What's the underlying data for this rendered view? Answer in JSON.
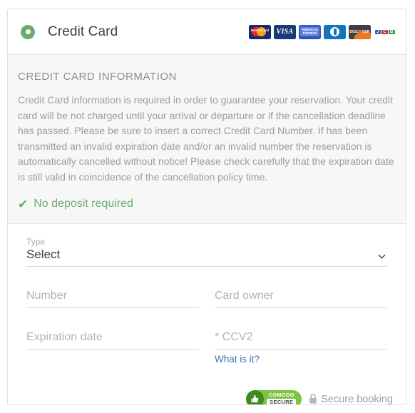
{
  "header": {
    "radio_icon": "radio-selected-icon",
    "title": "Credit Card",
    "card_logos": [
      {
        "name": "mastercard",
        "label": "MasterCard"
      },
      {
        "name": "visa",
        "label": "VISA"
      },
      {
        "name": "american-express",
        "label1": "AMERICAN",
        "label2": "EXPRESS"
      },
      {
        "name": "diners-club",
        "label": "Diners Club"
      },
      {
        "name": "discover",
        "label_a": "DISC",
        "label_b": "VER"
      },
      {
        "name": "jcb",
        "label1": "J",
        "label2": "C",
        "label3": "B"
      }
    ]
  },
  "info": {
    "heading": "CREDIT CARD INFORMATION",
    "paragraph": "Credit Card information is required in order to guarantee your reservation. Your credit card will be not charged until your arrival or departure or if the cancellation deadline has passed. Please be sure to insert a correct Credit Card Number. If has been transmitted an invalid expiration date and/or an invalid number the reservation is automatically cancelled without notice! Please check carefully that the expiration date is still valid in coincidence of the cancellation policy time.",
    "deposit_icon": "check-icon",
    "deposit_text": "No deposit required"
  },
  "form": {
    "type_label": "Type",
    "type_value": "Select",
    "type_chevron_icon": "chevron-down-icon",
    "number_placeholder": "Number",
    "card_owner_placeholder": "Card owner",
    "expiration_placeholder": "Expiration date",
    "ccv2_placeholder": "* CCV2",
    "ccv2_help_link": "What is it?"
  },
  "footer": {
    "comodo_line1": "COMODO",
    "comodo_line2": "SECURE",
    "comodo_icon": "thumbs-up-icon",
    "lock_icon": "lock-icon",
    "secure_text": "Secure booking"
  },
  "colors": {
    "accent_green": "#6aab6e",
    "check_green": "#5cb85c",
    "link_blue": "#3b75b3",
    "comodo_green": "#7dc242",
    "comodo_dark_green": "#3f8a1e",
    "text_gray": "#9a9da3",
    "heading_gray": "#8a8d93",
    "panel_bg": "#f7f7f7"
  }
}
